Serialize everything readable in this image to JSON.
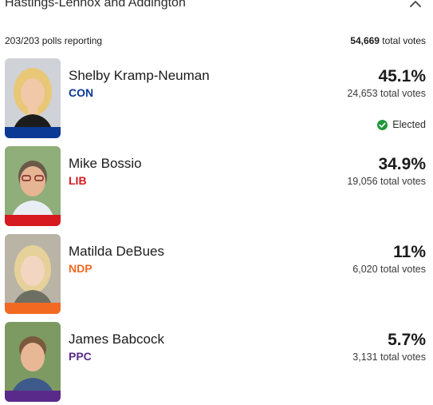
{
  "riding": {
    "title": "Hastings-Lennox and Addington",
    "polls_reporting": "203/203 polls reporting",
    "total_votes_number": "54,669",
    "total_votes_suffix": " total votes"
  },
  "colors": {
    "CON": "#0b3a94",
    "LIB": "#d71920",
    "NDP": "#f26a21",
    "PPC": "#5a2a8a",
    "elected_green": "#1f9a3b"
  },
  "candidates": [
    {
      "name": "Shelby Kramp-Neuman",
      "party": "CON",
      "percent": "45.1%",
      "votes": "24,653 total votes",
      "elected_label": "Elected"
    },
    {
      "name": "Mike Bossio",
      "party": "LIB",
      "percent": "34.9%",
      "votes": "19,056 total votes"
    },
    {
      "name": "Matilda DeBues",
      "party": "NDP",
      "percent": "11%",
      "votes": "6,020 total votes"
    },
    {
      "name": "James Babcock",
      "party": "PPC",
      "percent": "5.7%",
      "votes": "3,131 total votes"
    }
  ]
}
